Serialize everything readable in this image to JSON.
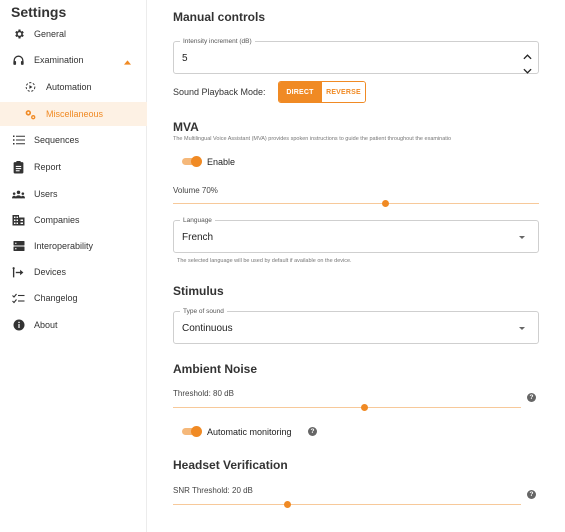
{
  "sidebar": {
    "title": "Settings",
    "items": [
      {
        "label": "General",
        "icon": "gear-icon"
      },
      {
        "label": "Examination",
        "icon": "headphones-icon"
      },
      {
        "label": "Automation",
        "icon": "automation-icon"
      },
      {
        "label": "Miscellaneous",
        "icon": "gears-icon"
      },
      {
        "label": "Sequences",
        "icon": "list-icon"
      },
      {
        "label": "Report",
        "icon": "report-icon"
      },
      {
        "label": "Users",
        "icon": "users-icon"
      },
      {
        "label": "Companies",
        "icon": "building-icon"
      },
      {
        "label": "Interoperability",
        "icon": "server-icon"
      },
      {
        "label": "Devices",
        "icon": "devices-icon"
      },
      {
        "label": "Changelog",
        "icon": "checklist-icon"
      },
      {
        "label": "About",
        "icon": "info-icon"
      }
    ]
  },
  "manual": {
    "title": "Manual controls",
    "intensity_label": "Intensity increment (dB)",
    "intensity_value": "5",
    "playback_label": "Sound Playback Mode:",
    "direct": "DIRECT",
    "reverse": "REVERSE"
  },
  "mva": {
    "title": "MVA",
    "description": "The Multilingual Voice Assistant (MVA) provides spoken instructions to guide the patient throughout the examinatio",
    "enable_label": "Enable",
    "volume_label": "Volume 70%",
    "volume": 0.7,
    "language_label": "Language",
    "language_value": "French",
    "language_help": "The selected language will be used by default if available on the device."
  },
  "stimulus": {
    "title": "Stimulus",
    "sound_label": "Type of sound",
    "sound_value": "Continuous"
  },
  "ambient": {
    "title": "Ambient Noise",
    "threshold_label": "Threshold: 80 dB",
    "threshold_fraction": 0.55,
    "auto_label": "Automatic monitoring"
  },
  "headset": {
    "title": "Headset Verification",
    "snr_label": "SNR Threshold: 20 dB",
    "snr_fraction": 0.33
  },
  "colors": {
    "accent": "#f08a24",
    "accent_light": "#f7c99a",
    "active_bg": "#fdf1e4"
  }
}
